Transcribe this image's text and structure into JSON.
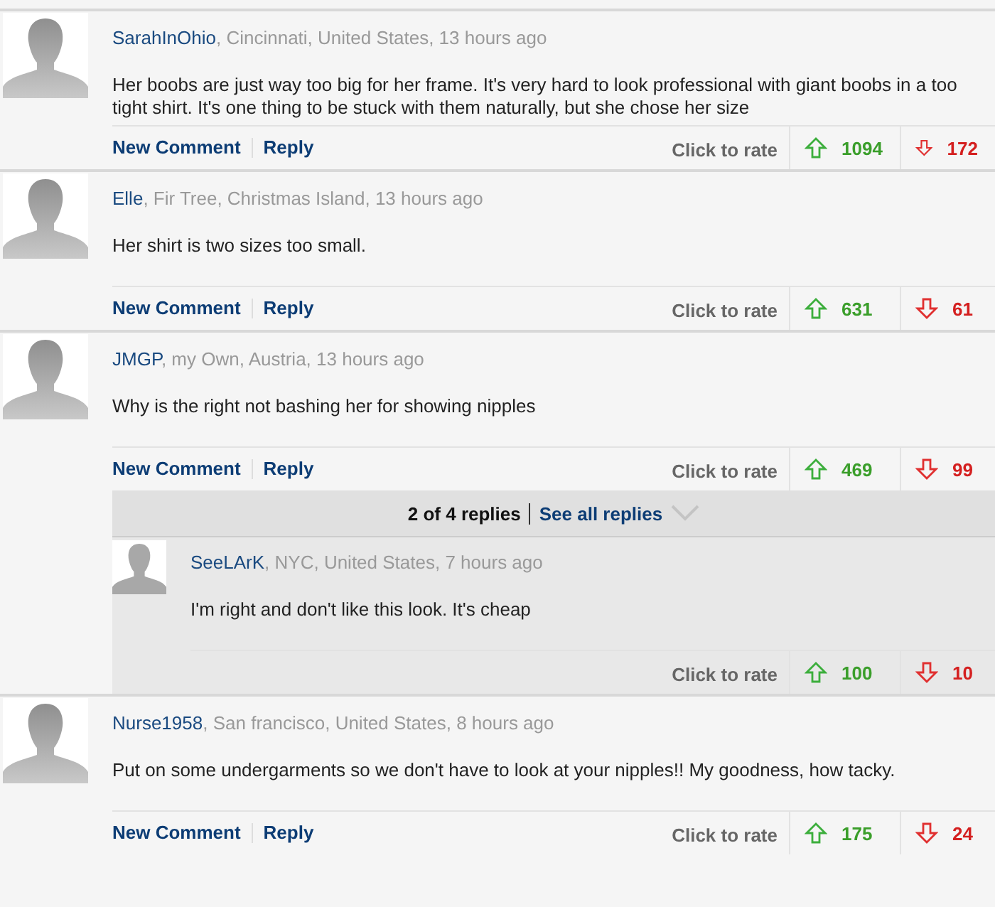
{
  "comments": [
    {
      "user": "SarahInOhio",
      "meta": ", Cincinnati, United States, 13 hours ago",
      "text": "Her boobs are just way too big for her frame. It's very hard to look professional with giant boobs in a too tight shirt. It's one thing to be stuck with them naturally, but she chose her size",
      "actions": [
        "New Comment",
        "Reply"
      ],
      "rate_label": "Click to rate",
      "up": "1094",
      "down": "172"
    },
    {
      "user": "Elle",
      "meta": ", Fir Tree, Christmas Island, 13 hours ago",
      "text": "Her shirt is two sizes too small.",
      "actions": [
        "New Comment",
        "Reply"
      ],
      "rate_label": "Click to rate",
      "up": "631",
      "down": "61"
    },
    {
      "user": "JMGP",
      "meta": ", my Own, Austria, 13 hours ago",
      "text": "Why is the right not bashing her for showing nipples",
      "actions": [
        "New Comment",
        "Reply"
      ],
      "rate_label": "Click to rate",
      "up": "469",
      "down": "99",
      "replies_bar": {
        "count": "2 of 4 replies",
        "link": "See all replies"
      },
      "replies": [
        {
          "user": "SeeLArK",
          "meta": ", NYC, United States, 7 hours ago",
          "text": "I'm right and don't like this look. It's cheap",
          "rate_label": "Click to rate",
          "up": "100",
          "down": "10"
        }
      ]
    },
    {
      "user": "Nurse1958",
      "meta": ", San francisco, United States, 8 hours ago",
      "text": "Put on some undergarments so we don't have to look at your nipples!! My goodness, how tacky.",
      "actions": [
        "New Comment",
        "Reply"
      ],
      "rate_label": "Click to rate",
      "up": "175",
      "down": "24"
    }
  ]
}
